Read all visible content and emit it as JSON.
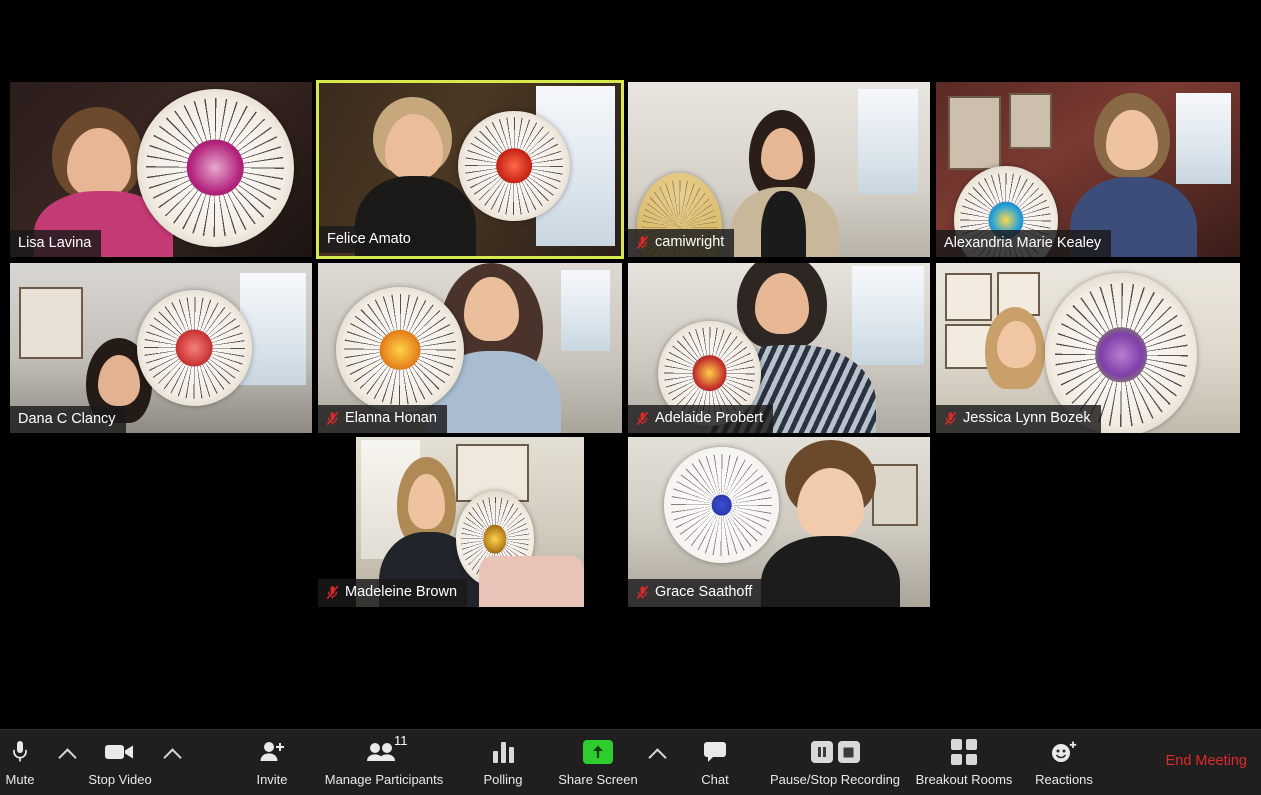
{
  "app": {
    "name": "Zoom Meeting",
    "view": "gallery",
    "background_color": "#000000",
    "active_speaker_border_color": "#d8e94f",
    "toolbar_color": "#1f1f1f",
    "end_meeting_color": "#e02828"
  },
  "gallery": {
    "participants": [
      {
        "name": "Lisa Lavina",
        "muted": false,
        "active_speaker": false,
        "row": 1,
        "col": 1,
        "letterboxed": false
      },
      {
        "name": "Felice Amato",
        "muted": false,
        "active_speaker": true,
        "row": 1,
        "col": 2,
        "letterboxed": false
      },
      {
        "name": "camiwright",
        "muted": true,
        "active_speaker": false,
        "row": 1,
        "col": 3,
        "letterboxed": false
      },
      {
        "name": "Alexandria Marie Kealey",
        "muted": false,
        "active_speaker": false,
        "row": 1,
        "col": 4,
        "letterboxed": false
      },
      {
        "name": "Dana C Clancy",
        "muted": false,
        "active_speaker": false,
        "row": 2,
        "col": 1,
        "letterboxed": false
      },
      {
        "name": "Elanna Honan",
        "muted": true,
        "active_speaker": false,
        "row": 2,
        "col": 2,
        "letterboxed": false
      },
      {
        "name": "Adelaide Probert",
        "muted": true,
        "active_speaker": false,
        "row": 2,
        "col": 3,
        "letterboxed": false
      },
      {
        "name": "Jessica Lynn Bozek",
        "muted": true,
        "active_speaker": false,
        "row": 2,
        "col": 4,
        "letterboxed": false
      },
      {
        "name": "Madeleine Brown",
        "muted": true,
        "active_speaker": false,
        "row": 3,
        "col": 2,
        "letterboxed": true
      },
      {
        "name": "Grace Saathoff",
        "muted": true,
        "active_speaker": false,
        "row": 3,
        "col": 3,
        "letterboxed": false
      }
    ]
  },
  "toolbar": {
    "items": [
      {
        "id": "mute",
        "label": "Mute",
        "icon": "microphone-icon",
        "has_caret": true
      },
      {
        "id": "stop-video",
        "label": "Stop Video",
        "icon": "video-camera-icon",
        "has_caret": true
      },
      {
        "id": "invite",
        "label": "Invite",
        "icon": "person-add-icon",
        "has_caret": false
      },
      {
        "id": "manage-participants",
        "label": "Manage Participants",
        "icon": "people-icon",
        "has_caret": false,
        "badge": "11"
      },
      {
        "id": "polling",
        "label": "Polling",
        "icon": "bar-chart-icon",
        "has_caret": false
      },
      {
        "id": "share-screen",
        "label": "Share Screen",
        "icon": "share-arrow-up-icon",
        "has_caret": true
      },
      {
        "id": "chat",
        "label": "Chat",
        "icon": "speech-bubble-icon",
        "has_caret": false
      },
      {
        "id": "pause-stop-recording",
        "label": "Pause/Stop Recording",
        "icon": "pause-stop-icon",
        "has_caret": false
      },
      {
        "id": "breakout-rooms",
        "label": "Breakout Rooms",
        "icon": "four-squares-icon",
        "has_caret": false
      },
      {
        "id": "reactions",
        "label": "Reactions",
        "icon": "smiley-plus-icon",
        "has_caret": false
      }
    ],
    "end_meeting_label": "End Meeting",
    "participant_count": "11"
  }
}
